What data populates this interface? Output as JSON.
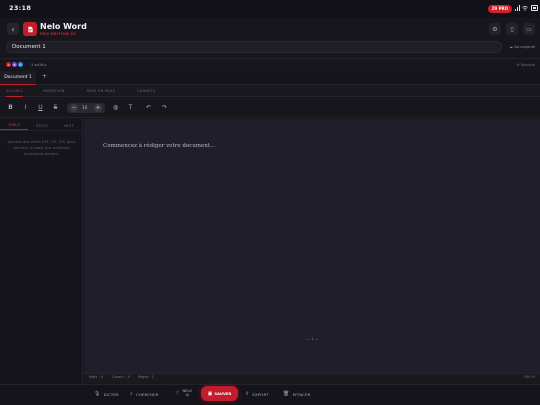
{
  "status_bar": {
    "time": "23:18",
    "battery_badge": "29 PRO"
  },
  "header": {
    "app_name": "Nelo Word",
    "edition": "PRO EDITION 25",
    "back_icon": "chevron-left-icon",
    "logo_icon": "document-icon",
    "actions": [
      "settings-icon",
      "layout-icon",
      "window-icon"
    ]
  },
  "document": {
    "title": "Document 1",
    "save_status": "Sauvegardé"
  },
  "collaborators": {
    "avatars": [
      {
        "initial": "A",
        "color": "#d4202d"
      },
      {
        "initial": "B",
        "color": "#7b4fd6"
      },
      {
        "initial": "C",
        "color": "#2f8fd6"
      }
    ],
    "online_text": "3 actifs ▸",
    "sync_text": "Synchro"
  },
  "doc_tabs": {
    "active": "Document 1",
    "add": "+"
  },
  "ribbon_tabs": [
    "ACCUEIL",
    "INSERTION",
    "MISE EN PAGE",
    "CARNETS"
  ],
  "toolbar": {
    "bold": "B",
    "italic": "I",
    "underline": "U",
    "strike": "S",
    "font_size_minus": "−",
    "font_size_value": "14",
    "font_size_plus": "+",
    "text": "T"
  },
  "side_panel": {
    "tabs": [
      "TABLE",
      "STATS",
      "HIST"
    ],
    "empty_text": "Ajoutez des titres (H1, H2, H3) pour générer la table des matières automatiquement."
  },
  "editor": {
    "placeholder": "Commencez à rédiger votre document...",
    "page_number": "— 1 —"
  },
  "footer_stats": {
    "words": "Mots : 0",
    "chars": "Caract. : 0",
    "pages": "Pages : 1",
    "zoom": "100 %"
  },
  "bottom_bar": {
    "dictate": "DICTER",
    "search": "CHERCHER",
    "nelo_ia_line1": "NELO",
    "nelo_ia_line2": "IA",
    "save": "SAUVER",
    "export": "EXPORT",
    "clear": "EFFACER"
  }
}
